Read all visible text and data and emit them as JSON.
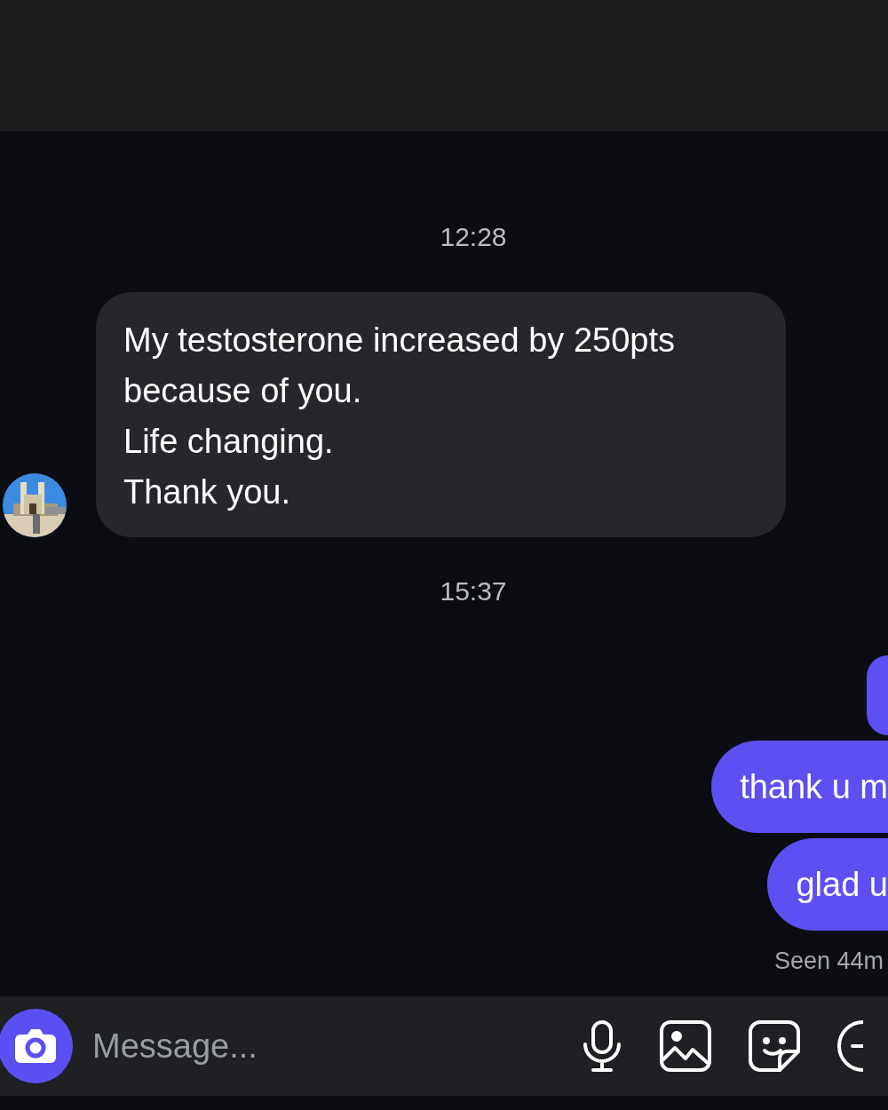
{
  "conversation": [
    {
      "kind": "timestamp",
      "text": "12:28"
    },
    {
      "kind": "incoming",
      "lines": [
        "My testosterone increased by 250pts",
        "because of you.",
        "Life changing.",
        "Thank you."
      ]
    },
    {
      "kind": "timestamp",
      "text": "15:37"
    },
    {
      "kind": "outgoing"
    },
    {
      "kind": "outgoing",
      "lines": [
        "thank u m"
      ]
    },
    {
      "kind": "outgoing",
      "lines": [
        "glad u"
      ]
    },
    {
      "kind": "receipt",
      "text": "Seen 44m"
    }
  ],
  "composer": {
    "placeholder": "Message..."
  }
}
